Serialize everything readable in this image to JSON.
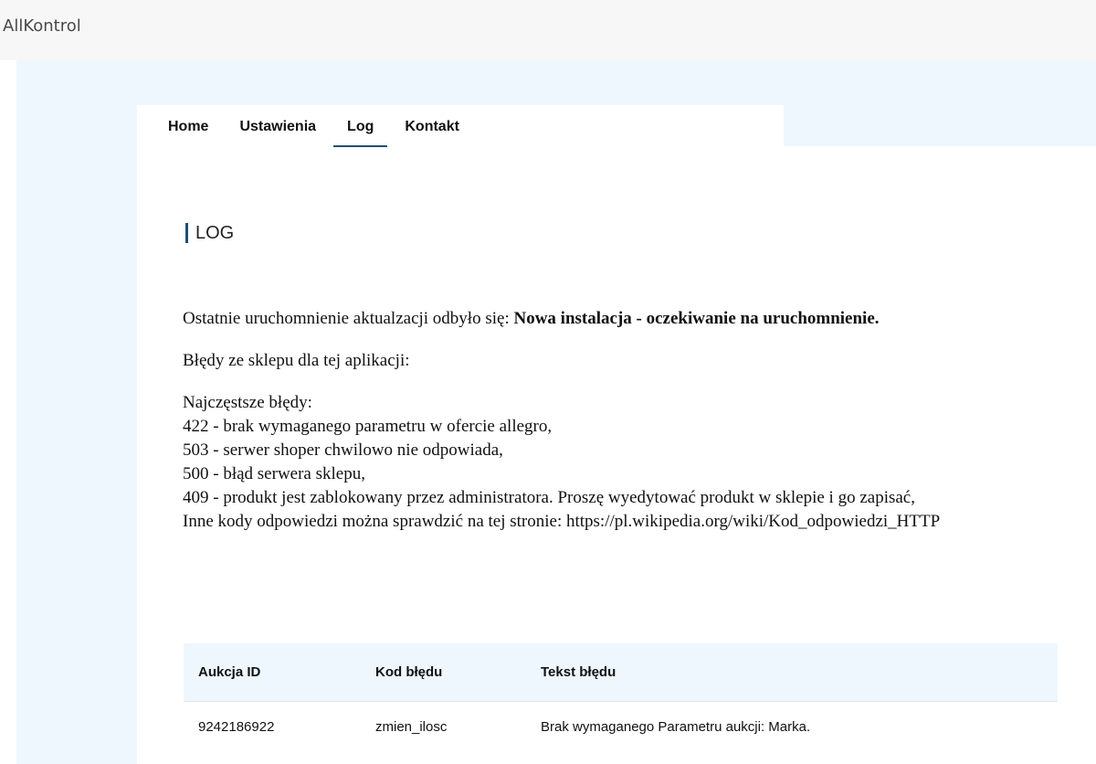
{
  "app": {
    "title": "AllKontrol"
  },
  "nav": {
    "tabs": [
      {
        "label": "Home",
        "active": false
      },
      {
        "label": "Ustawienia",
        "active": false
      },
      {
        "label": "Log",
        "active": true
      },
      {
        "label": "Kontakt",
        "active": false
      }
    ]
  },
  "page": {
    "heading": "LOG",
    "last_run_prefix": "Ostatnie uruchomnienie aktualzacji odbyło się: ",
    "last_run_status": "Nowa instalacja - oczekiwanie na uruchomnienie.",
    "errors_intro": "Błędy ze sklepu dla tej aplikacji:",
    "common_errors": {
      "title": "Najczęstsze błędy:",
      "items": [
        "422 - brak wymaganego parametru w ofercie allegro,",
        "503 - serwer shoper chwilowo nie odpowiada,",
        "500 - błąd serwera sklepu,",
        "409 - produkt jest zablokowany przez administratora. Proszę wyedytować produkt w sklepie i go zapisać,",
        "Inne kody odpowiedzi można sprawdzić na tej stronie: https://pl.wikipedia.org/wiki/Kod_odpowiedzi_HTTP"
      ]
    }
  },
  "errors_table": {
    "columns": [
      "Aukcja ID",
      "Kod błędu",
      "Tekst błędu"
    ],
    "rows": [
      [
        "9242186922",
        "zmien_ilosc",
        "Brak wymaganego Parametru aukcji: Marka."
      ]
    ]
  },
  "colors": {
    "accent": "#1d4f73",
    "background_light": "#eef7fd",
    "topbar": "#f7f7f7"
  }
}
